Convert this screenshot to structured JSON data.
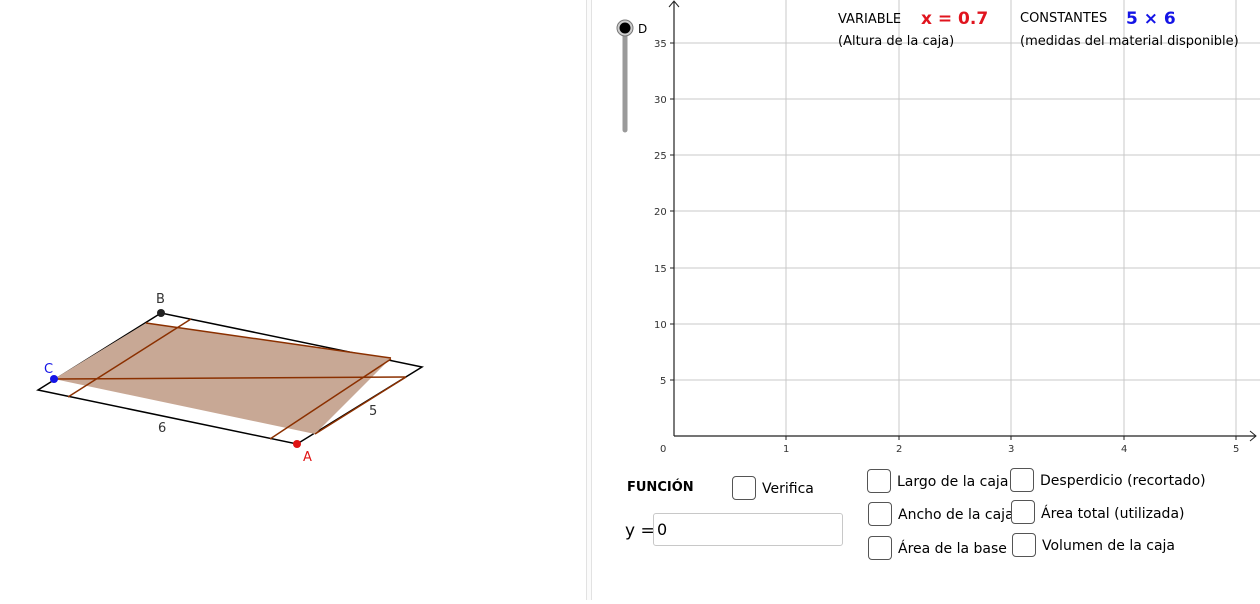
{
  "figure": {
    "point_labels": {
      "A": "A",
      "B": "B",
      "C": "C",
      "D": "D"
    },
    "side_labels": {
      "width": "6",
      "depth": "5"
    },
    "colors": {
      "sheet_fill": "#c8a895",
      "cut_lines": "#8b3000",
      "point_A": "#e01414",
      "point_B": "#222222",
      "point_C": "#1414e6"
    }
  },
  "slider": {
    "label": "D"
  },
  "header": {
    "variable_label": "VARIABLE",
    "variable_value": "x = 0.7",
    "variable_caption": "(Altura de la caja)",
    "constants_label": "CONSTANTES",
    "constants_value": "5 × 6",
    "constants_caption": "(medidas del material disponible)"
  },
  "graph": {
    "x_ticks": [
      "1",
      "2",
      "3",
      "4",
      "5"
    ],
    "y_ticks": [
      "5",
      "10",
      "15",
      "20",
      "25",
      "30",
      "35"
    ],
    "origin": "0"
  },
  "controls": {
    "funcion_label": "FUNCIÓN",
    "verifica_label": "Verifica",
    "y_prefix": "y =",
    "y_value": "0",
    "checkboxes": [
      {
        "label": "Largo de la caja"
      },
      {
        "label": "Ancho de la caja"
      },
      {
        "label": "Área de la base"
      },
      {
        "label": "Desperdicio (recortado)"
      },
      {
        "label": "Área total (utilizada)"
      },
      {
        "label": "Volumen de la caja"
      }
    ]
  }
}
